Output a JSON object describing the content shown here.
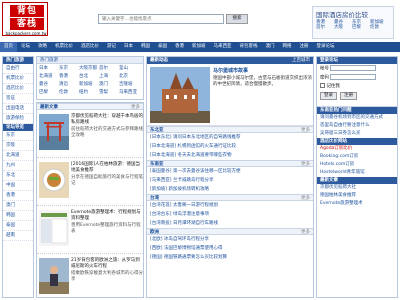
{
  "logo": {
    "line1": "背包",
    "line2": "客栈",
    "url": "backpackers.com.tw"
  },
  "search": {
    "placeholder": "输入关键字…也能找景点",
    "button": "搜索"
  },
  "compare": {
    "title": "国际酒店房价比较",
    "links": [
      "香港",
      "曼谷",
      "东京",
      "新加坡",
      "首尔",
      "大阪",
      "巴黎",
      "伦敦"
    ]
  },
  "nav": {
    "items": [
      "首页",
      "论坛",
      "攻略",
      "机票比价",
      "酒店比价",
      "游记",
      "日本",
      "韩国",
      "泰国",
      "香港",
      "新加坡",
      "马来西亚",
      "背包客栈",
      "澳门",
      "网络",
      "注册",
      "登录论坛"
    ]
  },
  "left": {
    "header1": "热门旅游",
    "items1": [
      "自由行",
      "机票比价",
      "酒店比价",
      "签证",
      "出国电话",
      "旅游保险"
    ],
    "header2": "论坛导览",
    "items2": [
      "东京",
      "京阪",
      "北海道",
      "九州",
      "东北",
      "中国",
      "香港",
      "澳门",
      "韩国",
      "泰国",
      "越南"
    ]
  },
  "hotcity": {
    "header": "热门旅游",
    "cities": [
      "日本",
      "东京",
      "大阪京都",
      "首尔",
      "釜山",
      "北海道",
      "香港",
      "台北",
      "上海",
      "北京",
      "曼谷",
      "清迈",
      "新加坡",
      "澳门",
      "吉隆坡",
      "巴黎",
      "伦敦",
      "纽约",
      "雪梨",
      "马来西亚"
    ]
  },
  "latest": {
    "header": "最新文章",
    "more": "更多",
    "articles": [
      {
        "title": "京都伏见稻荷大社：穿越千本鸟居的私房路线",
        "desc": "前往稻荷大社的交通方式与参拜路线全攻略"
      },
      {
        "title": "[2016国际]人在柏林旅游：德国当地美食推荐",
        "desc": "分享在德国自助旅行的美食与行程笔记"
      },
      {
        "title": "Evernote旅游整理术：行程规划与资料整理",
        "desc": "善用Evernote整理旅行资料与行程表"
      },
      {
        "title": "21岁背包客的欧洲之旅：从罗马到威尼斯的火车行程",
        "desc": "搭乘欧铁穿梭意大利各城市的心得分享"
      }
    ]
  },
  "center": {
    "header": "最新动态",
    "more": "上百城市",
    "feature": {
      "title": "马尔堡城市故事",
      "text": "德国中部小城马尔堡，古堡与石板街道交织出浓浓的中世纪风情，适合慢慢散步。"
    },
    "sections": [
      {
        "name": "东北亚",
        "more": "更多",
        "items": [
          "[日本东北] 请问日本东北地区的自驾路线推荐",
          "[日本北海道] 札幌到函馆的火车通行证比较",
          "[日本北海道] 冬天去北海道要带哪些衣物"
        ]
      },
      {
        "name": "东南亚",
        "more": "更多",
        "items": [
          "[泰国曼谷] 第一次去曼谷该住哪一区比较方便",
          "[马来西亚] 兰卡威跳岛行程分享",
          "[新加坡] 新加坡机场转机攻略"
        ]
      },
      {
        "name": "台湾",
        "more": "更多",
        "items": [
          "[台湾花莲] 太鲁阁一日游行程规划",
          "[台湾台东] 绿岛浮潜注意事项",
          "[台湾南投] 日月潭环湖自行车路线"
        ]
      },
      {
        "name": "欧洲",
        "more": "更多",
        "items": [
          "[北欧] 冰岛自驾环岛行程分享",
          "[西欧] 法国巴黎博物馆通票使用心得",
          "[德国] 德国铁路通票要怎么买比较划算"
        ]
      }
    ]
  },
  "login": {
    "header": "登录论坛",
    "user_label": "帐号",
    "pass_label": "密码",
    "remember": "记住我",
    "login_btn": "登录",
    "register_btn": "注册"
  },
  "right": {
    "header2": "东南亚热门问题",
    "items2": [
      "请问曼谷机场到市区的交通方式",
      "峇里岛自由行要注意什么",
      "吴哥窟三日券怎么买"
    ],
    "header3": "酒店比价网站",
    "items3": [
      "Agoda订房比价",
      "Booking.com订房",
      "Hotels.com订房",
      "Hostelworld青年旅馆"
    ],
    "header4": "最新文章",
    "items4": [
      "京都伏见稻荷大社",
      "德国柏林美食推荐",
      "Evernote旅游整理术"
    ]
  }
}
